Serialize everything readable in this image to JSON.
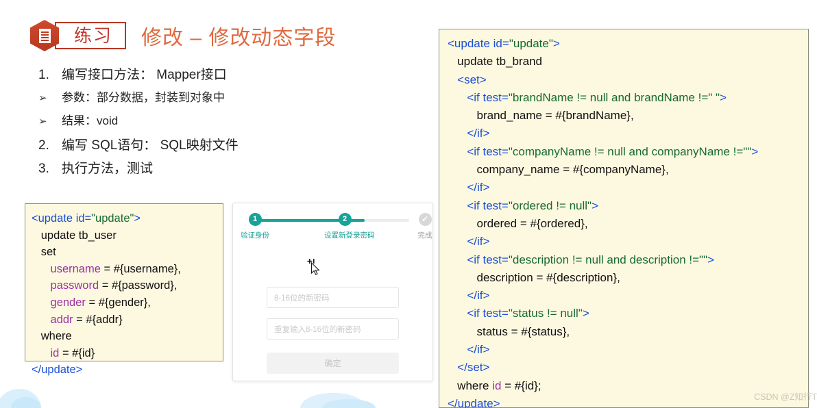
{
  "header": {
    "badge_icon": "document-hexagon-icon",
    "badge_label": "练习",
    "title": "修改 – 修改动态字段"
  },
  "steps_list": [
    {
      "marker": "1.",
      "text": "编写接口方法： Mapper接口",
      "kind": "numbered"
    },
    {
      "marker": "➢",
      "text": "参数：部分数据，封装到对象中",
      "kind": "sub"
    },
    {
      "marker": "➢",
      "text": "结果：void",
      "kind": "sub"
    },
    {
      "marker": "2.",
      "text": "编写 SQL语句： SQL映射文件",
      "kind": "numbered"
    },
    {
      "marker": "3.",
      "text": "执行方法，测试",
      "kind": "numbered"
    }
  ],
  "code_left": {
    "lines": [
      [
        {
          "t": "tag",
          "s": "<update "
        },
        {
          "t": "attr",
          "s": "id="
        },
        {
          "t": "val",
          "s": "\"update\""
        },
        {
          "t": "tag",
          "s": ">"
        }
      ],
      [
        {
          "t": "plain",
          "s": "   update tb_user"
        }
      ],
      [
        {
          "t": "plain",
          "s": "   set"
        }
      ],
      [
        {
          "t": "plain",
          "s": "      "
        },
        {
          "t": "field",
          "s": "username"
        },
        {
          "t": "plain",
          "s": " = #{username},"
        }
      ],
      [
        {
          "t": "plain",
          "s": "      "
        },
        {
          "t": "field",
          "s": "password"
        },
        {
          "t": "plain",
          "s": " = #{password},"
        }
      ],
      [
        {
          "t": "plain",
          "s": "      "
        },
        {
          "t": "field",
          "s": "gender"
        },
        {
          "t": "plain",
          "s": " = #{gender},"
        }
      ],
      [
        {
          "t": "plain",
          "s": "      "
        },
        {
          "t": "field",
          "s": "addr"
        },
        {
          "t": "plain",
          "s": " = #{addr}"
        }
      ],
      [
        {
          "t": "plain",
          "s": "   where"
        }
      ],
      [
        {
          "t": "plain",
          "s": "      "
        },
        {
          "t": "field",
          "s": "id"
        },
        {
          "t": "plain",
          "s": " = #{id}"
        }
      ],
      [
        {
          "t": "tag",
          "s": "</update>"
        }
      ]
    ]
  },
  "code_right": {
    "lines": [
      [
        {
          "t": "tag",
          "s": "<update "
        },
        {
          "t": "attr",
          "s": "id="
        },
        {
          "t": "val",
          "s": "\"update\""
        },
        {
          "t": "tag",
          "s": ">"
        }
      ],
      [
        {
          "t": "plain",
          "s": "   update tb_brand"
        }
      ],
      [
        {
          "t": "plain",
          "s": "   "
        },
        {
          "t": "tag",
          "s": "<set>"
        }
      ],
      [
        {
          "t": "plain",
          "s": "      "
        },
        {
          "t": "tag",
          "s": "<"
        },
        {
          "t": "attr",
          "s": "if test="
        },
        {
          "t": "val",
          "s": "\"brandName != null and brandName !=\" \""
        },
        {
          "t": "tag",
          "s": ">"
        }
      ],
      [
        {
          "t": "plain",
          "s": "         brand_name = #{brandName},"
        }
      ],
      [
        {
          "t": "plain",
          "s": "      "
        },
        {
          "t": "tag",
          "s": "</if>"
        }
      ],
      [
        {
          "t": "plain",
          "s": "      "
        },
        {
          "t": "tag",
          "s": "<"
        },
        {
          "t": "attr",
          "s": "if test="
        },
        {
          "t": "val",
          "s": "\"companyName != null and companyName !=\"\""
        },
        {
          "t": "tag",
          "s": ">"
        }
      ],
      [
        {
          "t": "plain",
          "s": "         company_name = #{companyName},"
        }
      ],
      [
        {
          "t": "plain",
          "s": "      "
        },
        {
          "t": "tag",
          "s": "</if>"
        }
      ],
      [
        {
          "t": "plain",
          "s": "      "
        },
        {
          "t": "tag",
          "s": "<"
        },
        {
          "t": "attr",
          "s": "if test="
        },
        {
          "t": "val",
          "s": "\"ordered != null\""
        },
        {
          "t": "tag",
          "s": ">"
        }
      ],
      [
        {
          "t": "plain",
          "s": "         ordered = #{ordered},"
        }
      ],
      [
        {
          "t": "plain",
          "s": "      "
        },
        {
          "t": "tag",
          "s": "</if>"
        }
      ],
      [
        {
          "t": "plain",
          "s": "      "
        },
        {
          "t": "tag",
          "s": "<"
        },
        {
          "t": "attr",
          "s": "if test="
        },
        {
          "t": "val",
          "s": "\"description != null and description !=\"\""
        },
        {
          "t": "tag",
          "s": ">"
        }
      ],
      [
        {
          "t": "plain",
          "s": "         description = #{description},"
        }
      ],
      [
        {
          "t": "plain",
          "s": "      "
        },
        {
          "t": "tag",
          "s": "</if>"
        }
      ],
      [
        {
          "t": "plain",
          "s": "      "
        },
        {
          "t": "tag",
          "s": "<"
        },
        {
          "t": "attr",
          "s": "if test="
        },
        {
          "t": "val",
          "s": "\"status != null\""
        },
        {
          "t": "tag",
          "s": ">"
        }
      ],
      [
        {
          "t": "plain",
          "s": "         status = #{status},"
        }
      ],
      [
        {
          "t": "plain",
          "s": "      "
        },
        {
          "t": "tag",
          "s": "</if>"
        }
      ],
      [
        {
          "t": "plain",
          "s": "   "
        },
        {
          "t": "tag",
          "s": "</set>"
        }
      ],
      [
        {
          "t": "plain",
          "s": "   where "
        },
        {
          "t": "field",
          "s": "id"
        },
        {
          "t": "plain",
          "s": " = #{id};"
        }
      ],
      [
        {
          "t": "tag",
          "s": "</update>"
        }
      ]
    ]
  },
  "wizard": {
    "steps": [
      {
        "number": "1",
        "label": "验证身份",
        "state": "active"
      },
      {
        "number": "2",
        "label": "设置新登录密码",
        "state": "active"
      },
      {
        "number": "✓",
        "label": "完成",
        "state": "done"
      }
    ],
    "password_placeholder": "8-16位的新密码",
    "confirm_placeholder": "重复输入8-16位的新密码",
    "submit_label": "确定",
    "cursor_icon": "move-cursor-icon"
  },
  "watermark": "CSDN @Z知行T",
  "colors": {
    "brand_red": "#c0392b",
    "title_orange": "#e06a3f",
    "teal": "#17a398",
    "code_bg": "#fdf8e0",
    "tag_blue": "#1a4fd6",
    "value_green": "#166b2e",
    "field_purple": "#9b30a8",
    "deco_blue": "#d6eefb"
  }
}
